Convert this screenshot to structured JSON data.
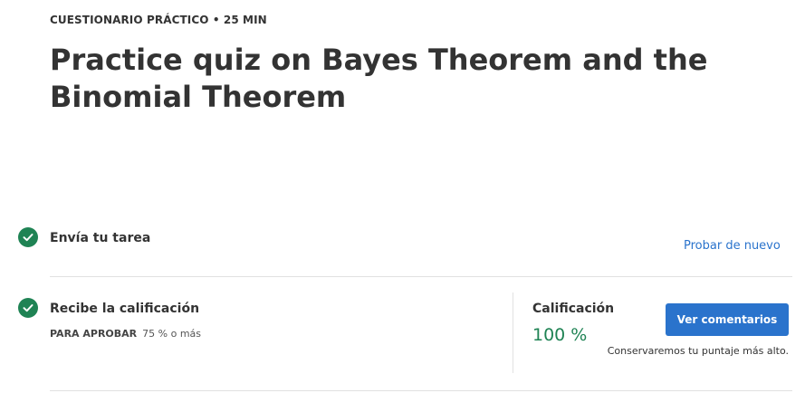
{
  "header": {
    "eyebrow": "CUESTIONARIO PRÁCTICO • 25 MIN",
    "title": "Practice quiz on Bayes Theorem and the Binomial Theorem"
  },
  "steps": [
    {
      "label": "Envía tu tarea",
      "status_icon": "check-circle-icon",
      "action_label": "Probar de nuevo"
    },
    {
      "label": "Recibe la calificación",
      "status_icon": "check-circle-icon",
      "pass_key": "PARA APROBAR",
      "pass_value": "75 % o más"
    }
  ],
  "grade": {
    "label": "Calificación",
    "value": "100 %",
    "button_label": "Ver comentarios",
    "note": "Conservaremos tu puntaje más alto."
  },
  "colors": {
    "success": "#1f8354",
    "primary": "#2a73cc",
    "text": "#333333",
    "divider": "#e1e1e1"
  }
}
